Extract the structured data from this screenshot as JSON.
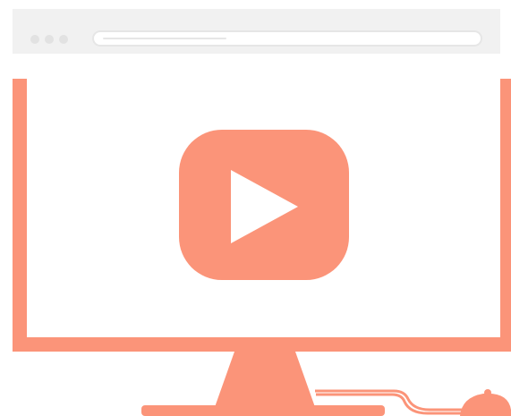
{
  "colors": {
    "accent": "#fb9479",
    "browser_chrome": "#f1f1f1",
    "screen": "#ffffff",
    "address_bar_border": "#e6e6e6",
    "window_dots": "#e2e2e2",
    "play_triangle": "#ffffff"
  },
  "icons": {
    "play": "play-icon",
    "monitor": "monitor-icon",
    "mouse": "mouse-icon"
  },
  "browser": {
    "address_bar": {
      "value": ""
    }
  }
}
